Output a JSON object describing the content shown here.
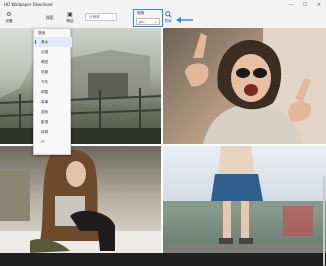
{
  "window": {
    "title": "HD Wallpaper Download",
    "controls": {
      "minimize": "—",
      "maximize": "☐",
      "close": "✕"
    }
  },
  "toolbar": {
    "settings_label": "设置",
    "search_label": "搜索",
    "filter_label": "筛选",
    "resolution_combo": {
      "value": "分辨率",
      "chevron": "⌄"
    },
    "search_group": {
      "caption": "搜索",
      "field_value": "girl",
      "clear_glyph": "✕"
    },
    "search_button_label": "搜索",
    "accent_color": "#2b8fd6"
  },
  "category_dropdown": {
    "header": "搜索",
    "items": [
      "美女",
      "动漫",
      "萌宠",
      "风景",
      "汽车",
      "明星",
      "军事",
      "游戏",
      "影视",
      "体育",
      "IT"
    ],
    "selected_index": 0
  },
  "wallpapers": [
    {
      "subject": "misty-forest-fence"
    },
    {
      "subject": "woman-sunglasses-peace-sign"
    },
    {
      "subject": "woman-long-hair-sitting"
    },
    {
      "subject": "woman-denim-skirt-street"
    }
  ]
}
